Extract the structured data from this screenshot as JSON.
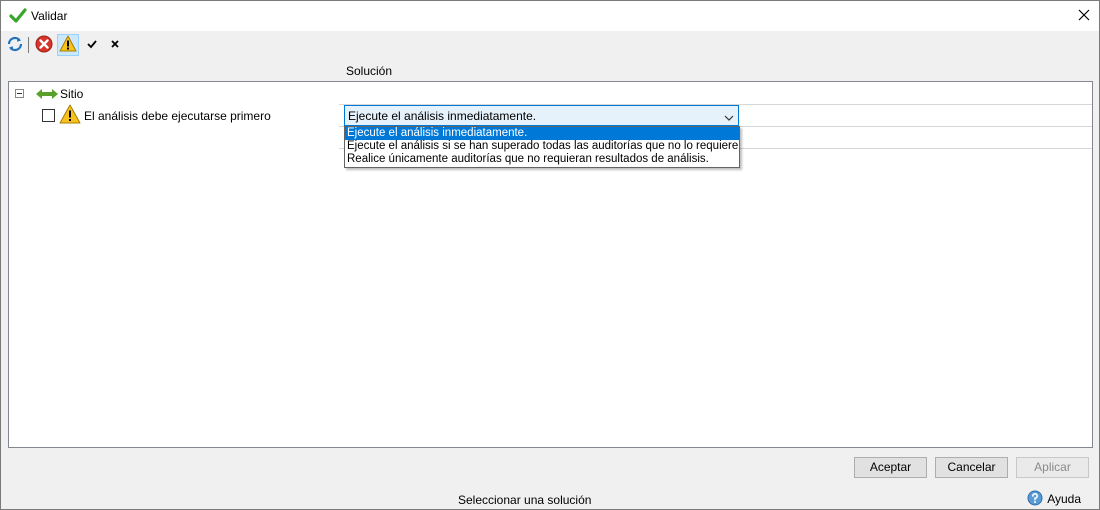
{
  "window": {
    "title": "Validar"
  },
  "toolbar": {
    "buttons": [
      {
        "icon": "refresh-icon"
      },
      {
        "icon": "error-filter-icon"
      },
      {
        "icon": "warning-filter-icon",
        "active": true
      },
      {
        "icon": "check-all-icon"
      },
      {
        "icon": "uncheck-all-icon"
      }
    ]
  },
  "grid": {
    "column_header": "Solución",
    "site": {
      "label": "Sitio",
      "icon": "site-icon"
    },
    "issue": {
      "label": "El análisis debe ejecutarse primero",
      "checked": false,
      "icon": "warning-icon",
      "solution_value": "Ejecute el análisis inmediatamente."
    },
    "solution_options": [
      "Ejecute el análisis inmediatamente.",
      "Ejecute el análisis si se han superado todas las auditorías que no lo requieren.",
      "Realice únicamente auditorías que no requieran resultados de análisis."
    ]
  },
  "buttons": {
    "ok": "Aceptar",
    "cancel": "Cancelar",
    "apply": "Aplicar"
  },
  "status": {
    "text": "Seleccionar una solución",
    "help_label": "Ayuda"
  },
  "colors": {
    "accent": "#0078d7",
    "warning": "#f7c21c",
    "error": "#d9342b",
    "site_green": "#5aa02c"
  }
}
